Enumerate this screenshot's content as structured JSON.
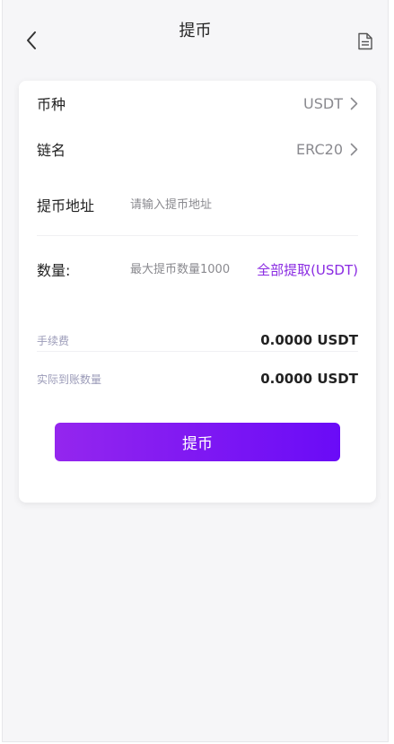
{
  "header": {
    "title": "提币",
    "back_icon": "chevron-left-icon",
    "record_icon": "document-icon"
  },
  "form": {
    "currency": {
      "label": "币种",
      "value": "USDT"
    },
    "chain": {
      "label": "链名",
      "value": "ERC20"
    },
    "address": {
      "label": "提币地址",
      "placeholder": "请输入提币地址",
      "value": ""
    },
    "amount": {
      "label": "数量:",
      "placeholder": "最大提币数量1000",
      "value": "",
      "all_label": "全部提取(USDT)"
    },
    "fee": {
      "label": "手续费",
      "value": "0.0000 USDT"
    },
    "actual": {
      "label": "实际到账数量",
      "value": "0.0000 USDT"
    },
    "submit_label": "提币"
  },
  "colors": {
    "accent": "#8a2be2",
    "button_gradient_start": "#9426ee",
    "button_gradient_end": "#6a0bf7"
  }
}
